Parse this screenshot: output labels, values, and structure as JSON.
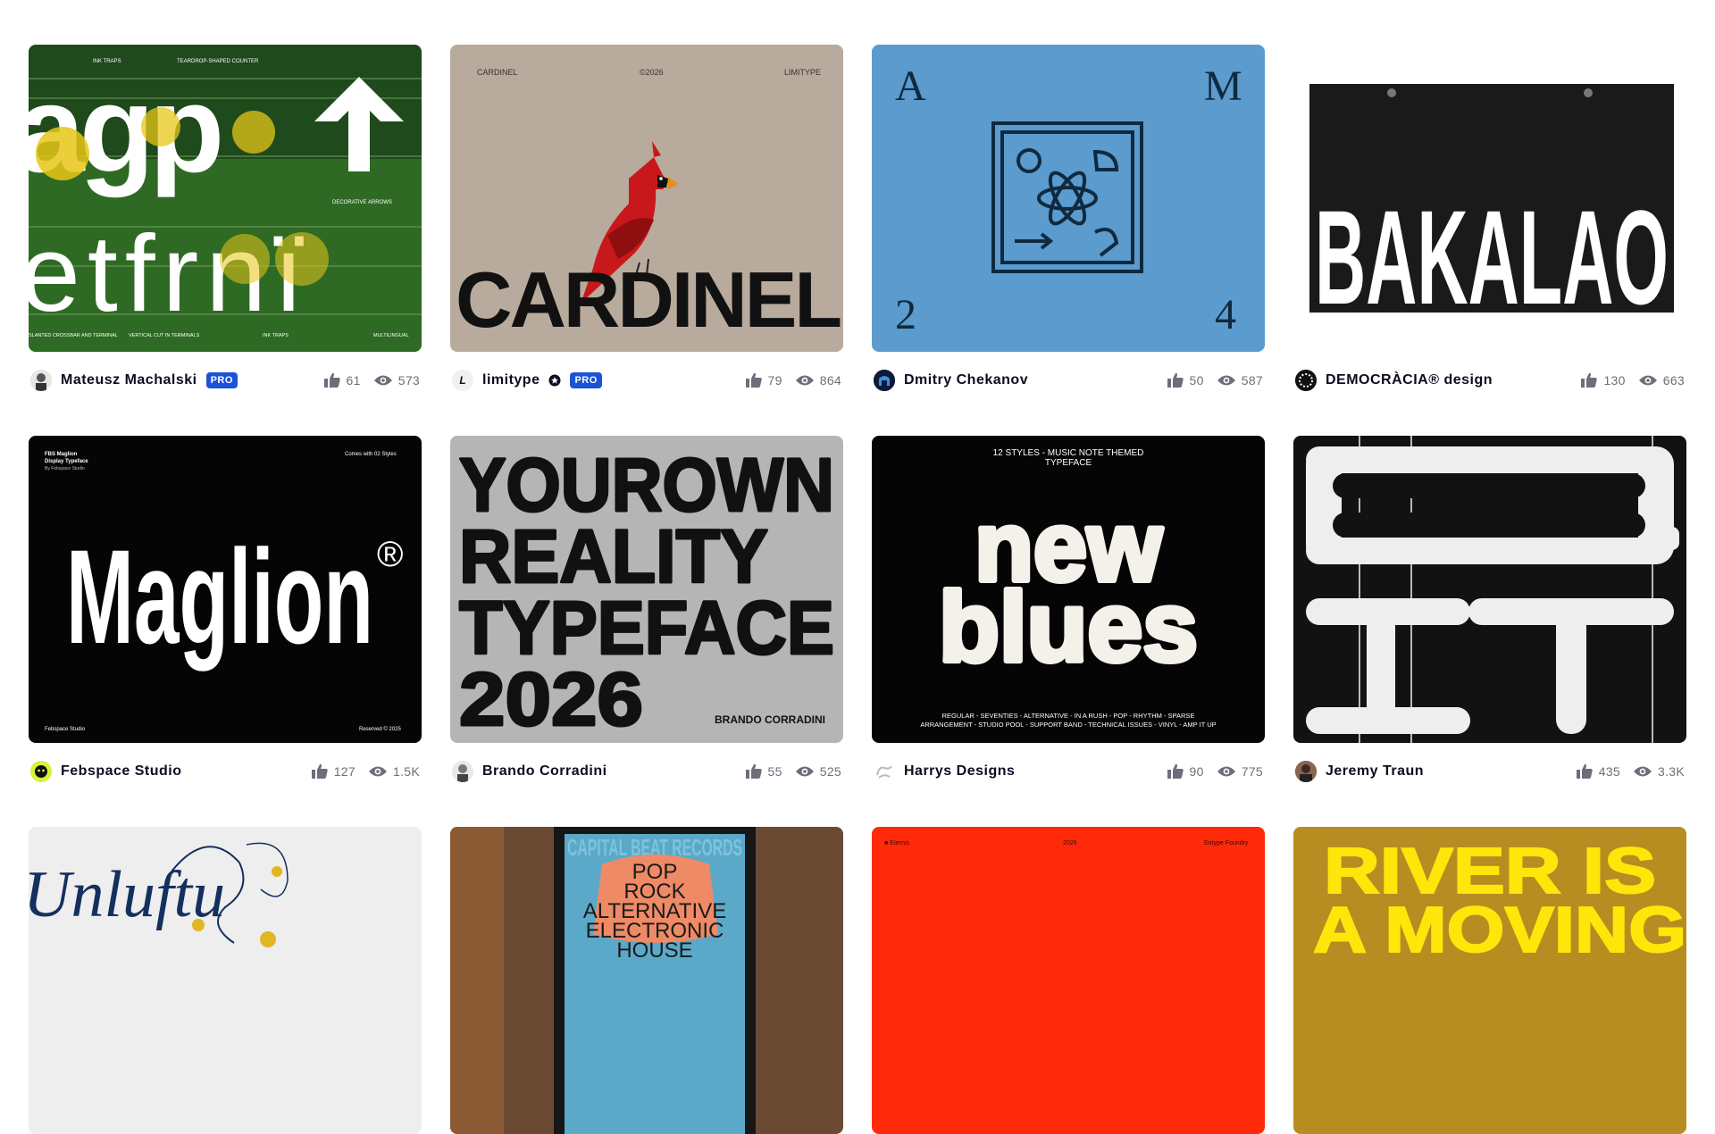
{
  "pro_label": "PRO",
  "shots": [
    {
      "author": "Mateusz Machalski",
      "pro": true,
      "likes": "61",
      "views": "573",
      "art": {
        "top_left": "INK TRAPS",
        "top_mid": "TEARDROP-SHAPED COUNTER",
        "glyphs_top": "agp",
        "side_note": "DECORATIVE ARROWS",
        "glyphs_bottom": "etfrnï",
        "foot_1": "SLANTED CROSSBAR AND TERMINAL",
        "foot_2": "VERTICAL CUT IN TERMINALS",
        "foot_3": "INK TRAPS",
        "foot_4": "MULTILINGUAL"
      }
    },
    {
      "author": "limitype",
      "pro": true,
      "verified": true,
      "likes": "79",
      "views": "864",
      "art": {
        "left": "CARDINEL",
        "mid": "©2026",
        "right": "LIMITYPE",
        "word": "CARDINEL"
      }
    },
    {
      "author": "Dmitry Chekanov",
      "pro": false,
      "likes": "50",
      "views": "587",
      "art": {
        "tl": "A",
        "tr": "M",
        "bl": "2",
        "br": "4"
      }
    },
    {
      "author": "DEMOCRÀCIA® design",
      "pro": false,
      "likes": "130",
      "views": "663",
      "art": {
        "word": "BAKALAO"
      }
    },
    {
      "author": "Febspace Studio",
      "pro": false,
      "likes": "127",
      "views": "1.5K",
      "art": {
        "tl_1": "FBS Maglion",
        "tl_2": "Display Typeface",
        "tl_3": "By Febspace Studio",
        "tr": "Comes with 02 Styles",
        "word": "Maglion",
        "mark": "®",
        "bl": "Febspace Studio",
        "br": "Reserved © 2025"
      }
    },
    {
      "author": "Brando Corradini",
      "pro": false,
      "likes": "55",
      "views": "525",
      "art": {
        "line1": "YOUROWN",
        "line2": "REALITY",
        "line3": "TYPEFACE",
        "line4": "2026",
        "credit": "BRANDO CORRADINI"
      }
    },
    {
      "author": "Harrys Designs",
      "pro": false,
      "likes": "90",
      "views": "775",
      "art": {
        "head_1": "12 STYLES - MUSIC NOTE THEMED",
        "head_2": "TYPEFACE",
        "word_1": "new",
        "word_2": "blues",
        "foot_1": "REGULAR - SEVENTIES - ALTERNATIVE - IN A RUSH - POP - RHYTHM - SPARSE",
        "foot_2": "ARRANGEMENT - STUDIO POOL - SUPPORT BAND - TECHNICAL ISSUES - VINYL - AMP IT UP"
      }
    },
    {
      "author": "Jeremy Traun",
      "pro": false,
      "likes": "435",
      "views": "3.3K",
      "art": {}
    },
    {
      "author": "",
      "pro": false,
      "likes": "",
      "views": "",
      "art": {
        "word": "Unluftu"
      }
    },
    {
      "author": "",
      "pro": false,
      "likes": "",
      "views": "",
      "art": {
        "head": "CAPITAL BEAT RECORDS",
        "l1": "POP",
        "l2": "ROCK",
        "l3": "ALTERNATIVE",
        "l4": "ELECTRONIC",
        "l5": "HOUSE"
      }
    },
    {
      "author": "",
      "pro": false,
      "likes": "",
      "views": "",
      "art": {
        "left": "■ Eternis",
        "mid": "2026",
        "right": "Entype Foundry"
      }
    },
    {
      "author": "",
      "pro": false,
      "likes": "",
      "views": "",
      "art": {
        "line1": "RIVER IS",
        "line2": "A MOVING"
      }
    }
  ],
  "colors": {
    "pro_badge": "#1a53d6",
    "meta_text": "#6e6d7a",
    "name_text": "#0d0c22"
  },
  "icons": {
    "likes": "thumbs-up-icon",
    "views": "eye-icon",
    "verified": "verified-badge-icon"
  }
}
